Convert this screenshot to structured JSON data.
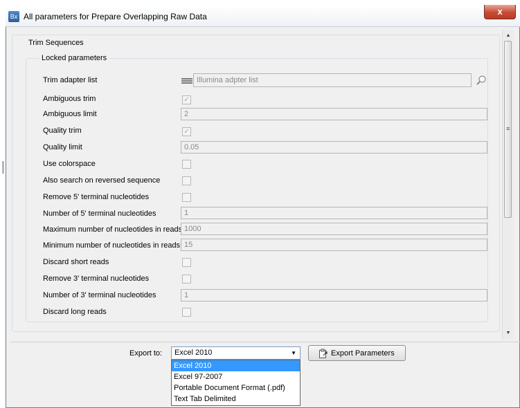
{
  "window": {
    "icon_text": "Bx",
    "title": "All parameters for Prepare Overlapping Raw Data",
    "close_glyph": "x"
  },
  "group_title": "Trim Sequences",
  "subgroup_title": "Locked parameters",
  "rows": {
    "trim_adapter_list": {
      "label": "Trim adapter list",
      "value": "Illumina adpter list"
    },
    "ambiguous_trim": {
      "label": "Ambiguous trim",
      "checked": true
    },
    "ambiguous_limit": {
      "label": "Ambiguous limit",
      "value": "2"
    },
    "quality_trim": {
      "label": "Quality trim",
      "checked": true
    },
    "quality_limit": {
      "label": "Quality limit",
      "value": "0.05"
    },
    "use_colorspace": {
      "label": "Use colorspace",
      "checked": false
    },
    "also_search_reversed": {
      "label": "Also search on reversed sequence",
      "checked": false
    },
    "remove_5_terminal": {
      "label": "Remove 5' terminal nucleotides",
      "checked": false
    },
    "number_5_terminal": {
      "label": "Number of 5' terminal nucleotides",
      "value": "1"
    },
    "max_nucleotides": {
      "label": "Maximum number of nucleotides in reads",
      "value": "1000"
    },
    "min_nucleotides": {
      "label": "Minimum number of nucleotides in reads",
      "value": "15"
    },
    "discard_short_reads": {
      "label": "Discard short reads",
      "checked": false
    },
    "remove_3_terminal": {
      "label": "Remove 3' terminal nucleotides",
      "checked": false
    },
    "number_3_terminal": {
      "label": "Number of 3' terminal nucleotides",
      "value": "1"
    },
    "discard_long_reads": {
      "label": "Discard long reads",
      "checked": false
    }
  },
  "export": {
    "label": "Export to:",
    "selected": "Excel 2010",
    "button_label": "Export Parameters",
    "options": [
      "Excel 2010",
      "Excel 97-2007",
      "Portable Document Format (.pdf)",
      "Text Tab Delimited"
    ]
  },
  "colors": {
    "selection": "#3399ff",
    "close_button": "#c74b35"
  }
}
